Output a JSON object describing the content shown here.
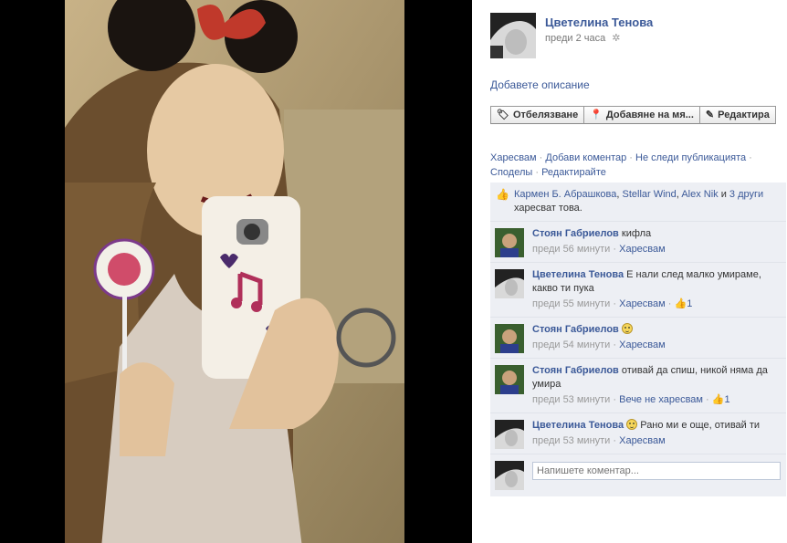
{
  "owner": {
    "name": "Цветелина Тенова",
    "time": "преди 2 часа"
  },
  "add_description": "Добавете описание",
  "toolbar": {
    "tag": "Отбелязване",
    "location": "Добавяне на мя...",
    "edit": "Редактира"
  },
  "actions": {
    "like": "Харесвам",
    "comment": "Добави коментар",
    "unfollow": "Не следи публикацията",
    "share": "Споделы",
    "edit": "Редактирайте",
    "sep": " · "
  },
  "likes": {
    "p1": "Кармен Б. Абрашкова",
    "sep1": ", ",
    "p2": "Stellar Wind",
    "sep2": ", ",
    "p3": "Alex Nik",
    "and": " и ",
    "others": "3 други",
    "tail": " харесват това."
  },
  "comments": [
    {
      "name": "Стоян Габриелов",
      "text": "кифла",
      "time": "преди 56 минути",
      "like": "Харесвам",
      "count": ""
    },
    {
      "name": "Цветелина Тенова",
      "text": "Е нали след малко умираме, какво ти пука",
      "time": "преди 55 минути",
      "like": "Харесвам",
      "count": "1"
    },
    {
      "name": "Стоян Габриелов",
      "text": "",
      "time": "преди 54 минути",
      "like": "Харесвам",
      "count": ""
    },
    {
      "name": "Стоян Габриелов",
      "text": "отивай да спиш, никой няма да умира",
      "time": "преди 53 минути",
      "like": "Вече не харесвам",
      "count": "1"
    },
    {
      "name": "Цветелина Тенова",
      "text": "Рано ми е още, отивай ти",
      "time": "преди 53 минути",
      "like": "Харесвам",
      "count": ""
    }
  ],
  "write": {
    "placeholder": "Напишете коментар..."
  }
}
